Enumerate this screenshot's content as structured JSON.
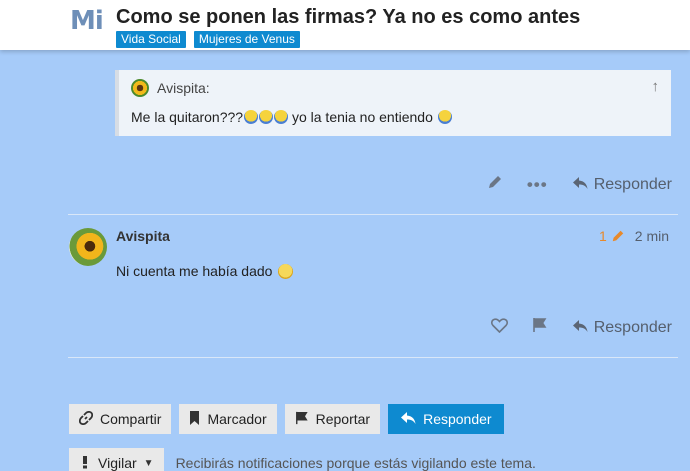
{
  "header": {
    "logo": "Mi",
    "title": "Como se ponen las firmas? Ya no es como antes",
    "categories": [
      "Vida Social",
      "Mujeres de Venus"
    ]
  },
  "quote": {
    "username": "Avispita:",
    "text": "Me la quitaron???",
    "text_after": " yo la tenia no entiendo "
  },
  "post1_actions": {
    "edit_icon": "pencil-icon",
    "more_icon": "ellipsis-icon",
    "reply_label": "Responder"
  },
  "post2": {
    "username": "Avispita",
    "edit_count": "1",
    "time": "2 min",
    "text": "Ni cuenta me había dado",
    "like_icon": "heart-icon",
    "flag_icon": "flag-icon",
    "reply_label": "Responder"
  },
  "footer": {
    "share_label": "Compartir",
    "bookmark_label": "Marcador",
    "report_label": "Reportar",
    "reply_label": "Responder",
    "watch_label": "Vigilar",
    "notify_text": "Recibirás notificaciones porque estás vigilando este tema."
  },
  "colors": {
    "page_bg": "#a6cbf9",
    "accent": "#0e8ad0",
    "edit_count": "#e7892c"
  }
}
